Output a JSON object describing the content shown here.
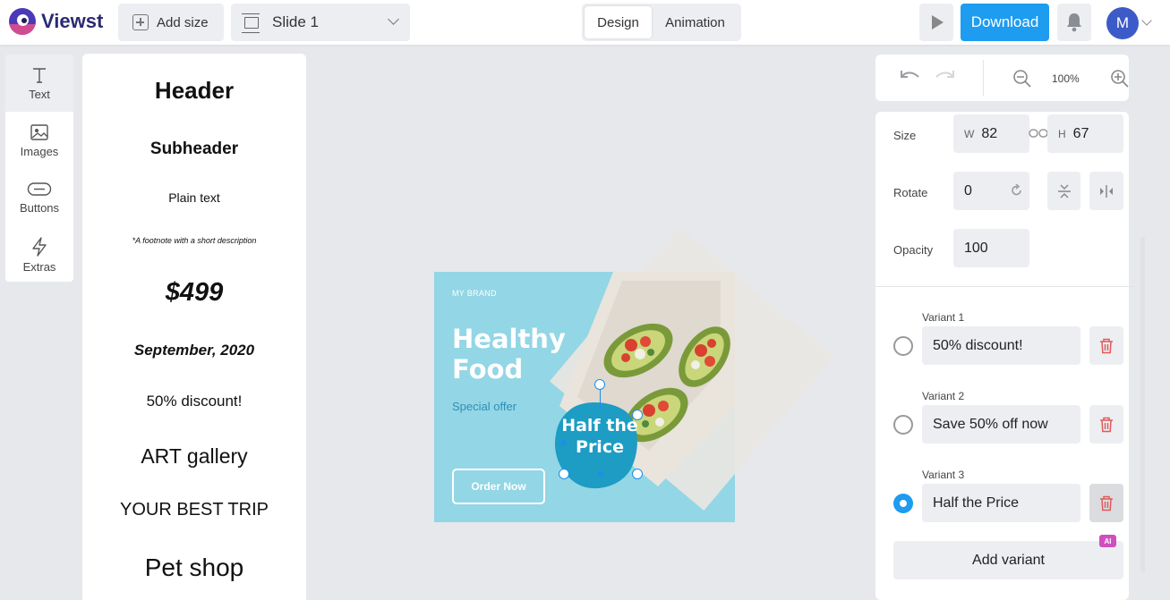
{
  "app": {
    "name": "Viewst"
  },
  "topbar": {
    "add_size": "Add size",
    "slide": "Slide 1",
    "tabs": {
      "design": "Design",
      "animation": "Animation"
    },
    "download": "Download",
    "avatar_initial": "M"
  },
  "rail": {
    "items": [
      {
        "label": "Text",
        "icon": "text-icon"
      },
      {
        "label": "Images",
        "icon": "image-icon"
      },
      {
        "label": "Buttons",
        "icon": "button-icon"
      },
      {
        "label": "Extras",
        "icon": "lightning-icon"
      }
    ]
  },
  "presets": {
    "items": [
      "Header",
      "Subheader",
      "Plain text",
      "*A footnote with a short description",
      "$499",
      "September, 2020",
      "50% discount!",
      "ART gallery",
      "YOUR BEST TRIP",
      "Pet shop"
    ]
  },
  "canvas": {
    "brand": "MY BRAND",
    "headline_line1": "Healthy",
    "headline_line2": "Food",
    "subhead": "Special offer",
    "cta": "Order Now",
    "badge_line1": "Half the",
    "badge_line2": "Price",
    "background_color": "#93d6e5",
    "badge_color": "#1d9cc4"
  },
  "history": {
    "zoom": "100%"
  },
  "properties": {
    "size_label": "Size",
    "w_prefix": "W",
    "w_value": "82",
    "h_prefix": "H",
    "h_value": "67",
    "rotate_label": "Rotate",
    "rotate_value": "0",
    "opacity_label": "Opacity",
    "opacity_value": "100",
    "variants": [
      {
        "label": "Variant 1",
        "value": "50% discount!",
        "selected": false
      },
      {
        "label": "Variant 2",
        "value": "Save 50% off now",
        "selected": false
      },
      {
        "label": "Variant 3",
        "value": "Half the Price",
        "selected": true
      }
    ],
    "add_variant": "Add variant",
    "ai_badge": "AI"
  },
  "colors": {
    "accent": "#1d9cf0",
    "delete": "#e05a5a",
    "brand": "#4a3ab8"
  }
}
